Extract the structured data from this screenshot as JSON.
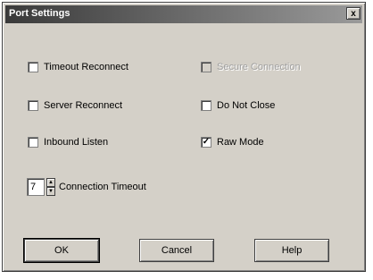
{
  "title": "Port Settings",
  "close_label": "x",
  "options": {
    "timeout_reconnect": {
      "label": "Timeout Reconnect",
      "checked": false,
      "enabled": true
    },
    "secure_connection": {
      "label": "Secure Connection",
      "checked": false,
      "enabled": false
    },
    "server_reconnect": {
      "label": "Server Reconnect",
      "checked": false,
      "enabled": true
    },
    "do_not_close": {
      "label": "Do Not Close",
      "checked": false,
      "enabled": true
    },
    "inbound_listen": {
      "label": "Inbound Listen",
      "checked": false,
      "enabled": true
    },
    "raw_mode": {
      "label": "Raw Mode",
      "checked": true,
      "enabled": true
    }
  },
  "connection_timeout": {
    "value": "7",
    "label": "Connection Timeout"
  },
  "buttons": {
    "ok": "OK",
    "cancel": "Cancel",
    "help": "Help"
  },
  "check_glyph": "✓",
  "spin_up_glyph": "▲",
  "spin_down_glyph": "▼"
}
